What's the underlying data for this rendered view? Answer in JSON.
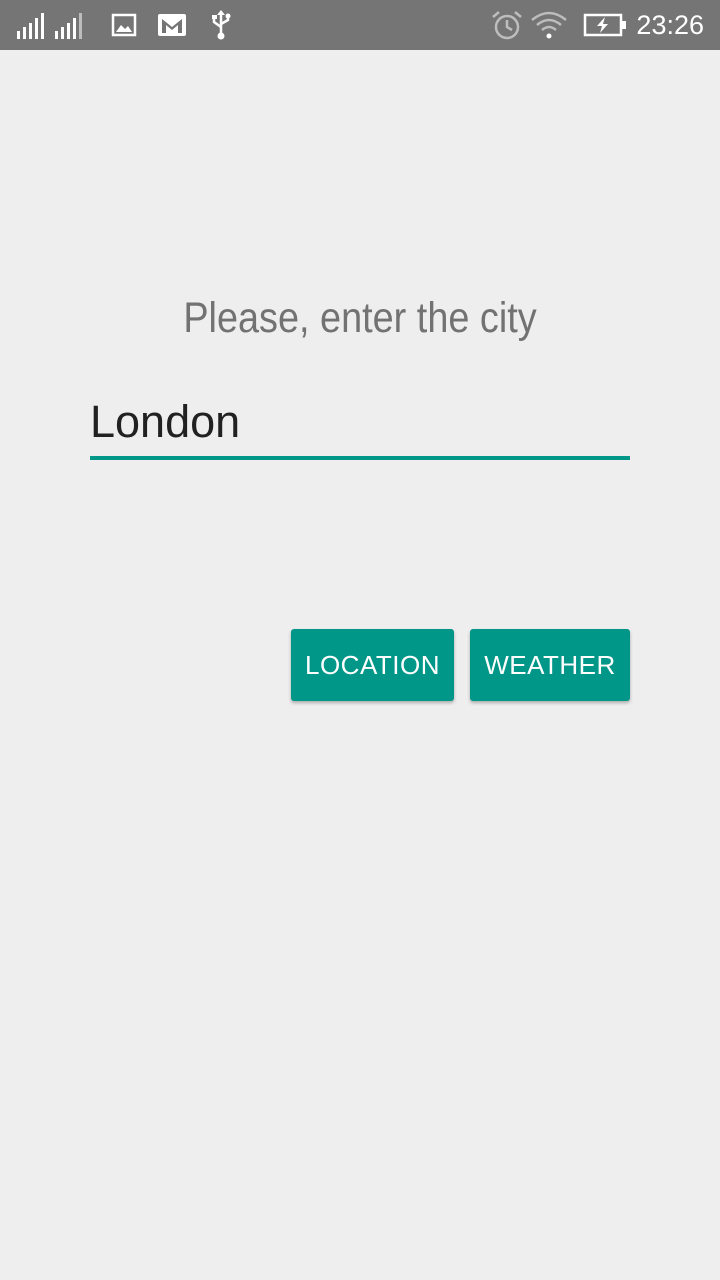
{
  "status_bar": {
    "time": "23:26",
    "background": "#757575",
    "left_icons": [
      "signal-sim1-icon",
      "signal-sim2-icon",
      "image-notification-icon",
      "gmail-icon",
      "usb-icon"
    ],
    "right_icons": [
      "alarm-icon",
      "wifi-icon",
      "battery-charging-icon"
    ]
  },
  "main": {
    "prompt": "Please, enter the city",
    "city_input_value": "London",
    "buttons": {
      "location_label": "LOCATION",
      "weather_label": "WEATHER"
    }
  },
  "colors": {
    "accent": "#009688",
    "background": "#eeeeee",
    "prompt_text": "#727272",
    "input_text": "#212121"
  }
}
